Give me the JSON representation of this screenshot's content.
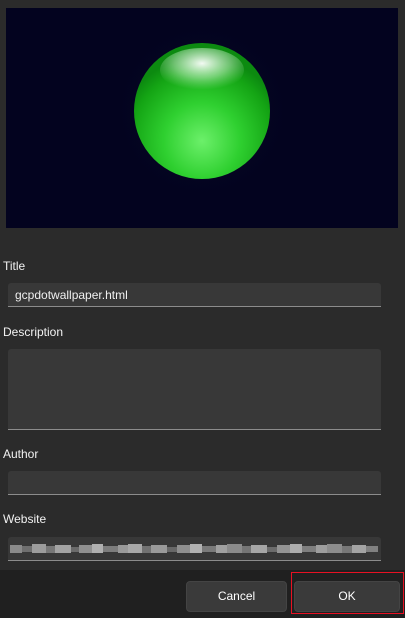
{
  "preview": {
    "image": "green-glossy-sphere-wallpaper",
    "background_color": "#03031f",
    "sphere_color": "#22c42a"
  },
  "fields": {
    "title": {
      "label": "Title",
      "value": "gcpdotwallpaper.html"
    },
    "description": {
      "label": "Description",
      "value": ""
    },
    "author": {
      "label": "Author",
      "value": ""
    },
    "website": {
      "label": "Website",
      "value": ""
    }
  },
  "footer": {
    "cancel_label": "Cancel",
    "ok_label": "OK"
  },
  "colors": {
    "focus_outline": "#e81123",
    "field_background": "#383838",
    "dialog_background": "#2b2b2b",
    "footer_background": "#202020"
  }
}
